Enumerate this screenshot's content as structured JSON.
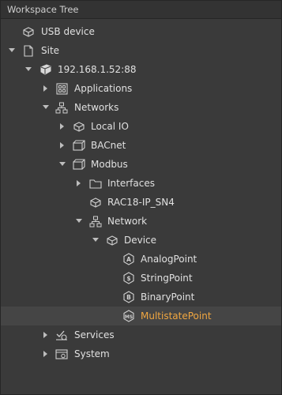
{
  "panel": {
    "title": "Workspace Tree"
  },
  "tree": {
    "usb_device": "USB device",
    "site": "Site",
    "ip": "192.168.1.52:88",
    "applications": "Applications",
    "networks": "Networks",
    "local_io": "Local IO",
    "bacnet": "BACnet",
    "modbus": "Modbus",
    "interfaces": "Interfaces",
    "rac18": "RAC18-IP_SN4",
    "network": "Network",
    "device": "Device",
    "analog_point": "AnalogPoint",
    "string_point": "StringPoint",
    "binary_point": "BinaryPoint",
    "multistate_point": "MultistatePoint",
    "services": "Services",
    "system": "System"
  },
  "selected": "MultistatePoint",
  "colors": {
    "background": "#3a3a3a",
    "text": "#e0e0e0",
    "selected_text": "#f0a640",
    "selected_row": "#454545"
  }
}
